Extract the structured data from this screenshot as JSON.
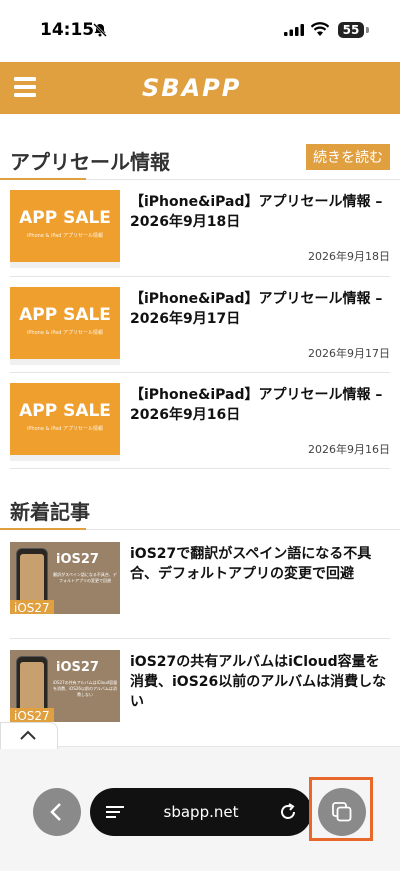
{
  "status_bar": {
    "time": "14:15",
    "battery": "55"
  },
  "header": {
    "logo": "SBAPP"
  },
  "sale_section": {
    "title": "アプリセール情報",
    "read_more": "続きを読む",
    "thumb_title": "APP SALE",
    "thumb_sub": "iPhone & iPad アプリセール情報",
    "items": [
      {
        "title": "【iPhone&iPad】アプリセール情報 – 2026年9月18日",
        "date": "2026年9月18日"
      },
      {
        "title": "【iPhone&iPad】アプリセール情報 – 2026年9月17日",
        "date": "2026年9月17日"
      },
      {
        "title": "【iPhone&iPad】アプリセール情報 – 2026年9月16日",
        "date": "2026年9月16日"
      }
    ]
  },
  "news_section": {
    "title": "新着記事",
    "items": [
      {
        "thumb_title": "iOS27",
        "thumb_sub": "翻訳がスペイン語になる不具合、デフォルトアプリの変更で回避",
        "tag": "iOS27",
        "title": "iOS27で翻訳がスペイン語になる不具合、デフォルトアプリの変更で回避"
      },
      {
        "thumb_title": "iOS27",
        "thumb_sub": "iOS27の共有アルバムはiCloud容量を消費、iOS26以前のアルバムは消費しない",
        "tag": "iOS27",
        "title": "iOS27の共有アルバムはiCloud容量を消費、iOS26以前のアルバムは消費しない"
      }
    ]
  },
  "browser": {
    "url": "sbapp.net"
  },
  "colors": {
    "accent": "#e0a040",
    "highlight": "#e8672a"
  }
}
